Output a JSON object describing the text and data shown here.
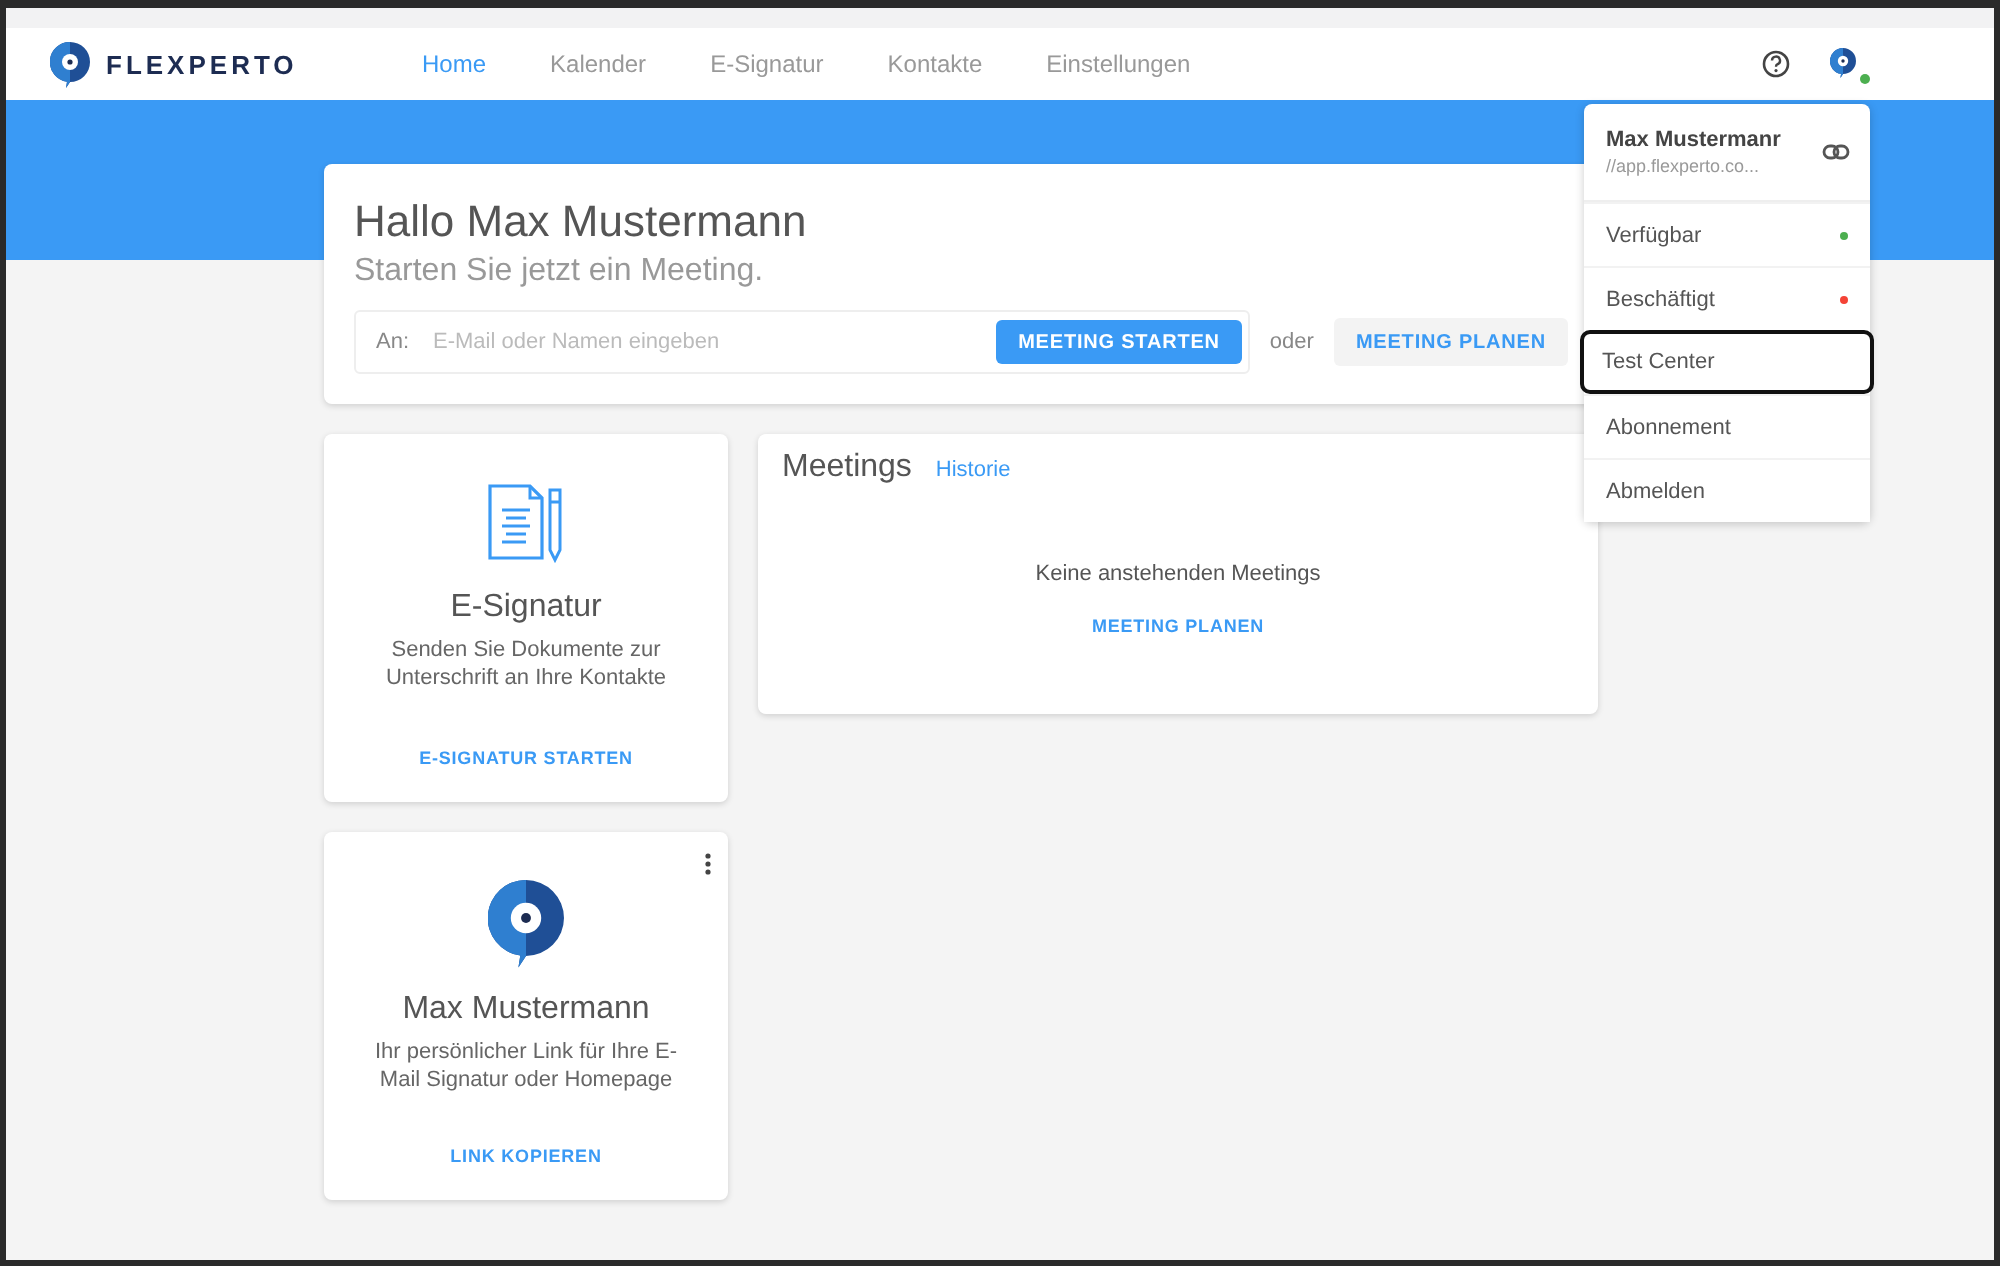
{
  "brand": {
    "name": "FLEXPERTO"
  },
  "nav": [
    {
      "label": "Home",
      "selected": true
    },
    {
      "label": "Kalender",
      "selected": false
    },
    {
      "label": "E-Signatur",
      "selected": false
    },
    {
      "label": "Kontakte",
      "selected": false
    },
    {
      "label": "Einstellungen",
      "selected": false
    }
  ],
  "user": {
    "online": true
  },
  "greeting": {
    "title": "Hallo Max Mustermann",
    "subtitle": "Starten Sie jetzt ein Meeting.",
    "to_label": "An:",
    "placeholder": "E-Mail oder Namen eingeben",
    "start_button": "MEETING STARTEN",
    "or": "oder",
    "plan_button": "MEETING PLANEN"
  },
  "esign_card": {
    "title": "E-Signatur",
    "text": "Senden Sie Dokumente zur Unterschrift an Ihre Kontakte",
    "action": "E-SIGNATUR STARTEN"
  },
  "meetings": {
    "title": "Meetings",
    "history_link": "Historie",
    "empty": "Keine anstehenden Meetings",
    "action": "MEETING PLANEN"
  },
  "profile_card": {
    "name": "Max Mustermann",
    "text": "Ihr persönlicher Link für Ihre E-Mail Signatur oder Homepage",
    "action": "LINK KOPIEREN"
  },
  "menu": {
    "name": "Max Mustermanr",
    "url": "//app.flexperto.co...",
    "items": [
      {
        "label": "Verfügbar",
        "selected": false,
        "color": "#4caf50"
      },
      {
        "label": "Beschäftigt",
        "selected": false,
        "color": "#f44336"
      },
      {
        "label": "Test Center",
        "selected": true
      },
      {
        "label": "Abonnement",
        "selected": false
      },
      {
        "label": "Abmelden",
        "selected": false
      }
    ]
  }
}
